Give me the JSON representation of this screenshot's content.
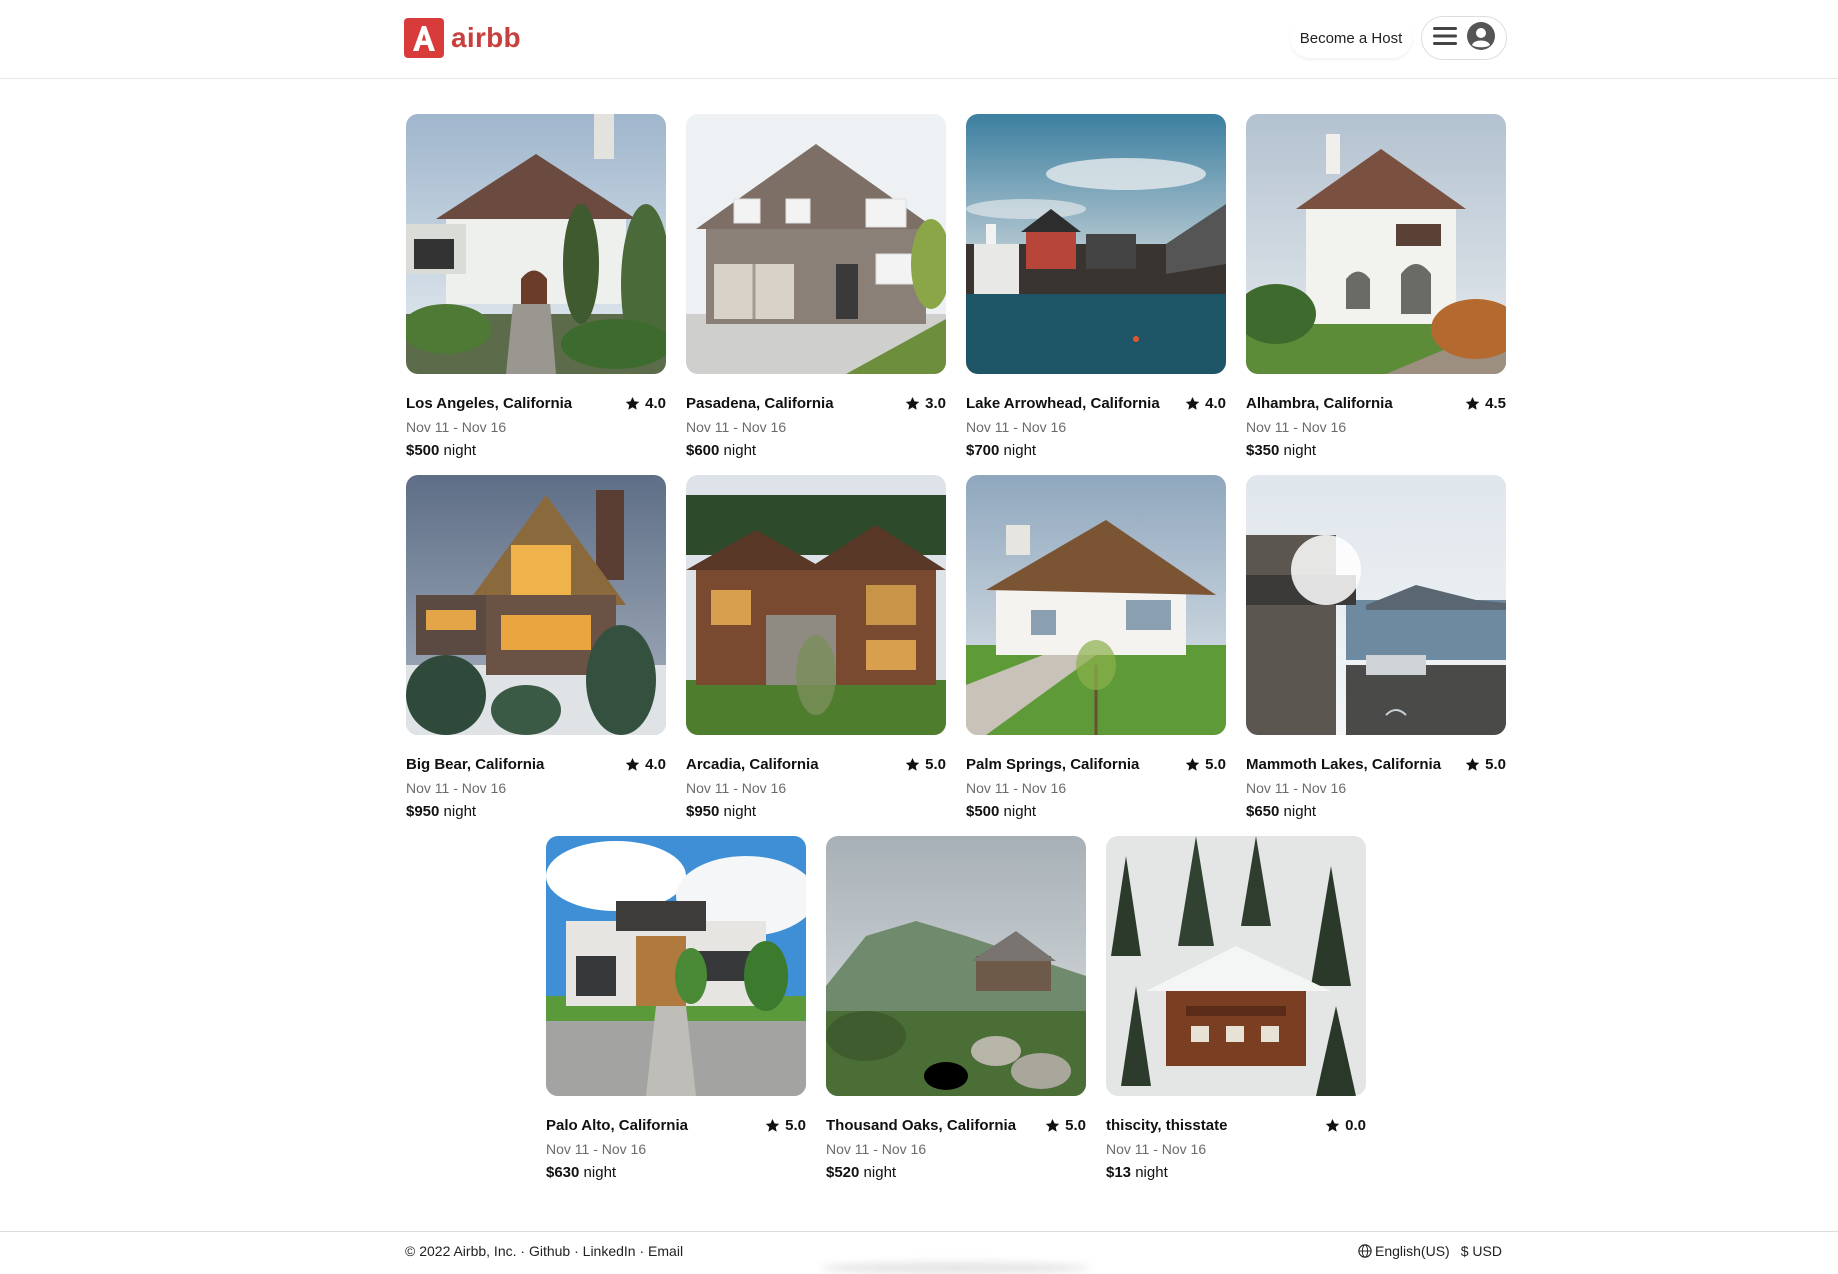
{
  "header": {
    "brand_letter": "A",
    "brand_name": "airbb",
    "host_label": "Become a Host",
    "menu_icon": "hamburger-icon",
    "avatar_icon": "user-avatar-icon"
  },
  "listings": [
    {
      "location": "Los Angeles, California",
      "rating": "4.0",
      "dates": "Nov 11 - Nov 16",
      "price": "$500",
      "unit": "night",
      "photo": "two-story stucco house with arched doorway and cypress trees"
    },
    {
      "location": "Pasadena, California",
      "rating": "3.0",
      "dates": "Nov 11 - Nov 16",
      "price": "$600",
      "unit": "night",
      "photo": "suburban two-story house with double garage"
    },
    {
      "location": "Lake Arrowhead, California",
      "rating": "4.0",
      "dates": "Nov 11 - Nov 16",
      "price": "$700",
      "unit": "night",
      "photo": "waterfront wooden houses on a lake"
    },
    {
      "location": "Alhambra, California",
      "rating": "4.5",
      "dates": "Nov 11 - Nov 16",
      "price": "$350",
      "unit": "night",
      "photo": "white villa with arched windows and garden"
    },
    {
      "location": "Big Bear, California",
      "rating": "4.0",
      "dates": "Nov 11 - Nov 16",
      "price": "$950",
      "unit": "night",
      "photo": "lit chalet at dusk with snow and pines"
    },
    {
      "location": "Arcadia, California",
      "rating": "5.0",
      "dates": "Nov 11 - Nov 16",
      "price": "$950",
      "unit": "night",
      "photo": "large timber and stone lodge"
    },
    {
      "location": "Palm Springs, California",
      "rating": "5.0",
      "dates": "Nov 11 - Nov 16",
      "price": "$500",
      "unit": "night",
      "photo": "white chalet-style house with lawn"
    },
    {
      "location": "Mammoth Lakes, California",
      "rating": "5.0",
      "dates": "Nov 11 - Nov 16",
      "price": "$650",
      "unit": "night",
      "photo": "lakeside stone house with sun glare"
    },
    {
      "location": "Palo Alto, California",
      "rating": "5.0",
      "dates": "Nov 11 - Nov 16",
      "price": "$630",
      "unit": "night",
      "photo": "modern house with wood panels and cloudy sky"
    },
    {
      "location": "Thousand Oaks, California",
      "rating": "5.0",
      "dates": "Nov 11 - Nov 16",
      "price": "$520",
      "unit": "night",
      "photo": "mountain cabin above rocky meadow"
    },
    {
      "location": "thiscity, thisstate",
      "rating": "0.0",
      "dates": "Nov 11 - Nov 16",
      "price": "$13",
      "unit": "night",
      "photo": "snowy wooden chalet among pine trees"
    }
  ],
  "footer": {
    "copyright": "© 2022 Airbb, Inc.",
    "sep": " · ",
    "links": [
      "Github",
      "LinkedIn",
      "Email"
    ],
    "language": "English(US)",
    "currency": "$ USD",
    "globe_icon": "globe-icon"
  },
  "colors": {
    "brand": "#d93b3b",
    "brand_text": "#c8403d"
  }
}
